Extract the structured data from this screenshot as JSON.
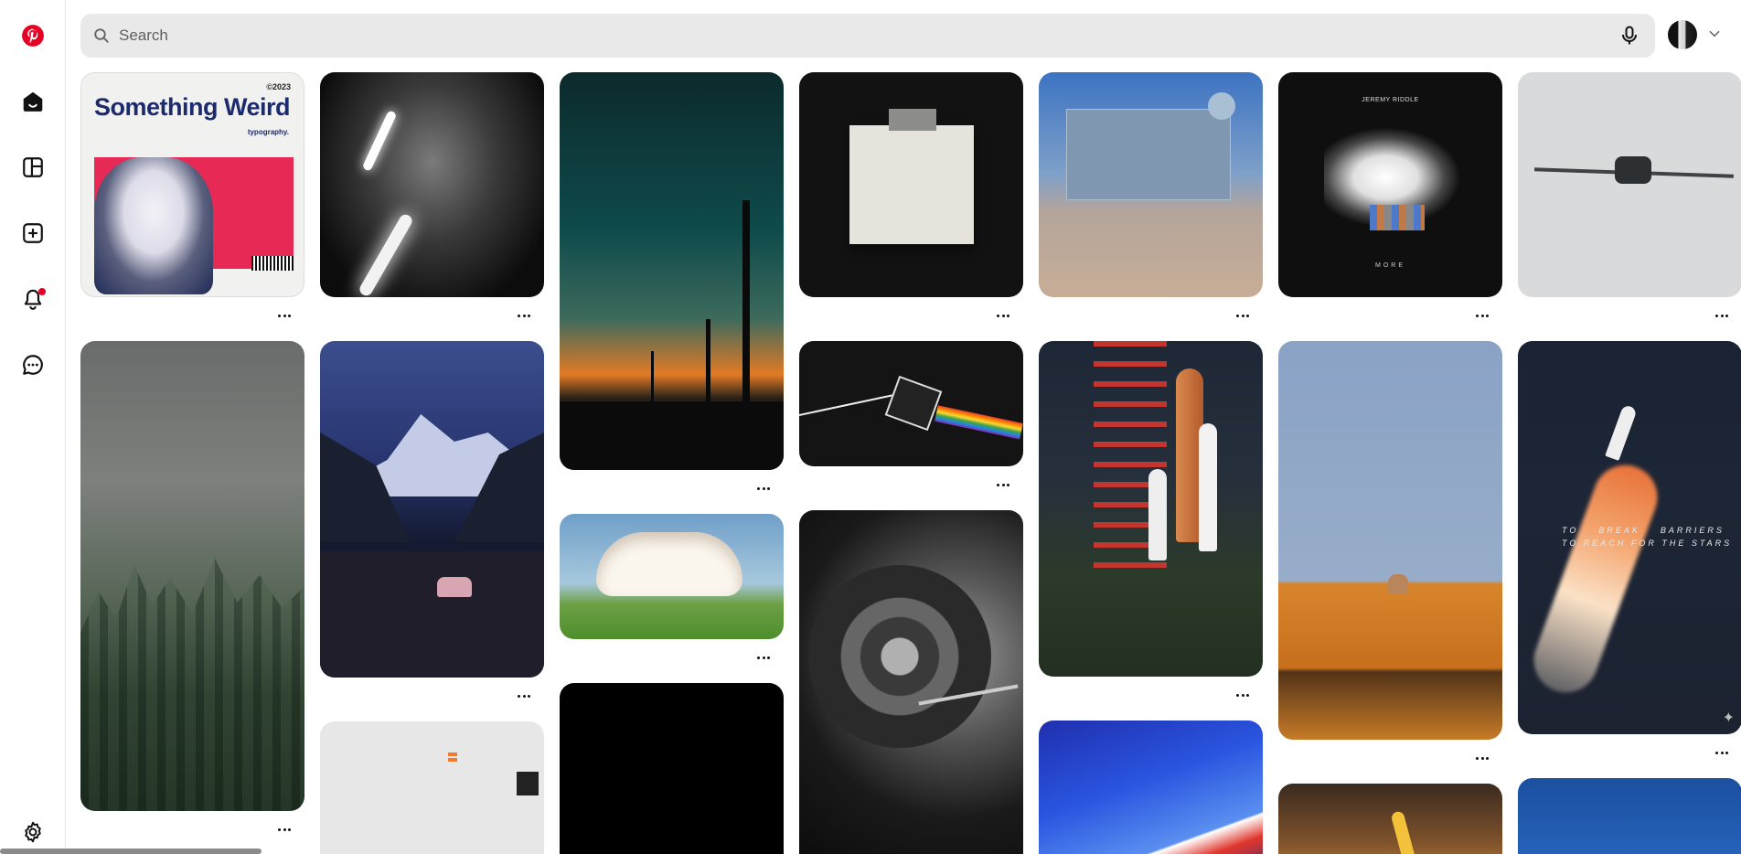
{
  "app": {
    "name": "Pinterest",
    "brand_color": "#e60023"
  },
  "sidebar": {
    "items": [
      {
        "name": "home",
        "icon": "home-icon",
        "active": true
      },
      {
        "name": "boards",
        "icon": "boards-icon"
      },
      {
        "name": "create",
        "icon": "plus-square-icon"
      },
      {
        "name": "notifications",
        "icon": "bell-icon",
        "has_badge": true
      },
      {
        "name": "messages",
        "icon": "chat-icon"
      },
      {
        "name": "settings",
        "icon": "gear-icon"
      }
    ]
  },
  "header": {
    "search_placeholder": "Search",
    "search_value": "",
    "mic_icon": "microphone-icon",
    "account_chevron": "chevron-down-icon"
  },
  "pins": {
    "poster": {
      "title": "Something Weird",
      "year": "©2023",
      "tag": "typography."
    },
    "album": {
      "artist": "JEREMY RIDDLE",
      "word": "MORE"
    },
    "rocket": {
      "text": "TO    BREAK    BARRIERS\nTO REACH FOR THE STARS"
    },
    "more_label": "..."
  }
}
